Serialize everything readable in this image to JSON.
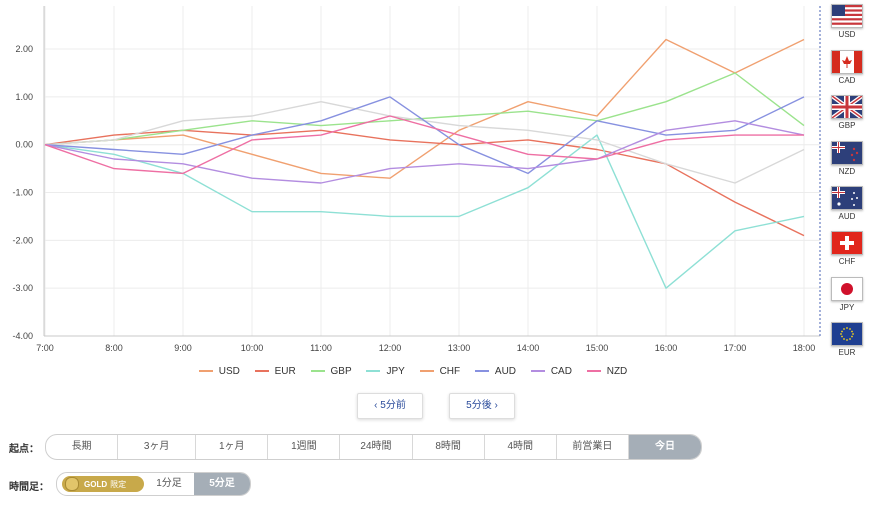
{
  "chart_data": {
    "type": "line",
    "x": [
      "7:00",
      "8:00",
      "9:00",
      "10:00",
      "11:00",
      "12:00",
      "13:00",
      "14:00",
      "15:00",
      "16:00",
      "17:00",
      "18:00"
    ],
    "x_ticks": [
      "7:00",
      "8:00",
      "9:00",
      "10:00",
      "11:00",
      "12:00",
      "13:00",
      "14:00",
      "15:00",
      "16:00",
      "17:00",
      "18:00"
    ],
    "y_ticks": [
      "2.00",
      "1.00",
      "0.00",
      "-1.00",
      "-2.00",
      "-3.00",
      "-4.00"
    ],
    "ylim": [
      -4,
      2.9
    ],
    "grid": true,
    "legend": "bottom",
    "series": [
      {
        "name": "USD",
        "color": "#f0a070",
        "values": [
          0.0,
          0.1,
          0.2,
          -0.2,
          -0.6,
          -0.7,
          0.3,
          0.9,
          0.6,
          2.2,
          1.5,
          2.2
        ]
      },
      {
        "name": "EUR",
        "color": "#e8725d",
        "values": [
          0.0,
          0.2,
          0.3,
          0.2,
          0.3,
          0.1,
          0.0,
          0.1,
          -0.1,
          -0.4,
          -1.2,
          -1.9
        ]
      },
      {
        "name": "GBP",
        "color": "#9be38d",
        "values": [
          0.0,
          0.1,
          0.3,
          0.5,
          0.4,
          0.5,
          0.6,
          0.7,
          0.5,
          0.9,
          1.5,
          0.4
        ]
      },
      {
        "name": "JPY",
        "color": "#8ee0d5",
        "values": [
          0.0,
          -0.2,
          -0.6,
          -1.4,
          -1.4,
          -1.5,
          -1.5,
          -0.9,
          0.2,
          -3.0,
          -1.8,
          -1.5
        ]
      },
      {
        "name": "CHF",
        "color": "#d8d8d8",
        "values": [
          0.0,
          0.1,
          0.5,
          0.6,
          0.9,
          0.6,
          0.4,
          0.3,
          0.1,
          -0.4,
          -0.8,
          -0.1
        ]
      },
      {
        "name": "AUD",
        "color": "#8791e0",
        "values": [
          0.0,
          -0.1,
          -0.2,
          0.2,
          0.5,
          1.0,
          0.0,
          -0.6,
          0.5,
          0.2,
          0.3,
          1.0
        ]
      },
      {
        "name": "CAD",
        "color": "#b38de0",
        "values": [
          0.0,
          -0.3,
          -0.4,
          -0.7,
          -0.8,
          -0.5,
          -0.4,
          -0.5,
          -0.3,
          0.3,
          0.5,
          0.2
        ]
      },
      {
        "name": "NZD",
        "color": "#ee6fa3",
        "values": [
          0.0,
          -0.5,
          -0.6,
          0.1,
          0.2,
          0.6,
          0.2,
          -0.2,
          -0.3,
          0.1,
          0.2,
          0.2
        ]
      }
    ]
  },
  "flags": [
    {
      "code": "USD",
      "icon": "us-flag-icon"
    },
    {
      "code": "CAD",
      "icon": "canada-flag-icon"
    },
    {
      "code": "GBP",
      "icon": "uk-flag-icon"
    },
    {
      "code": "NZD",
      "icon": "new-zealand-flag-icon"
    },
    {
      "code": "AUD",
      "icon": "australia-flag-icon"
    },
    {
      "code": "CHF",
      "icon": "switzerland-flag-icon"
    },
    {
      "code": "JPY",
      "icon": "japan-flag-icon"
    },
    {
      "code": "EUR",
      "icon": "eu-flag-icon"
    }
  ],
  "nav": {
    "prev": "‹ 5分前",
    "next": "5分後 ›"
  },
  "period": {
    "label": "起点：",
    "options": [
      "長期",
      "3ヶ月",
      "1ヶ月",
      "1週間",
      "24時間",
      "8時間",
      "4時間",
      "前営業日",
      "今日"
    ],
    "selected": "今日"
  },
  "timeframe": {
    "label": "時間足：",
    "gold_label": "GOLD",
    "gold_sub": "限定",
    "options": [
      "1分足",
      "5分足"
    ],
    "selected": "5分足"
  }
}
